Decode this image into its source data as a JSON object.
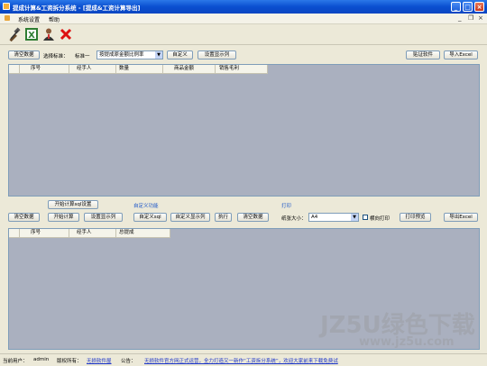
{
  "window": {
    "title": "提成计算&工资拆分系统 - [提成&工资计算导出]"
  },
  "menu": {
    "items": [
      "系统设置",
      "帮助"
    ],
    "controls": [
      "_",
      "❐",
      "×"
    ]
  },
  "top": {
    "clear_data": "清空数据",
    "select_label": "选择标准：",
    "standard_value": "标准一",
    "standard_combo": "按提成原金额比例率",
    "custom": "自定义",
    "set_columns": "设置显示列",
    "paste_software": "贴证软件",
    "import_excel": "导入Excel",
    "columns": [
      "序号",
      "经手人",
      "数量",
      "商品金额",
      "销售毛利"
    ]
  },
  "middle": {
    "start_calc_sql": "开始计算sql设置",
    "custom_func_label": "自定义功能",
    "print_label": "打印",
    "clear_data": "清空数据",
    "start_calc": "开始计算",
    "set_columns": "设置显示列",
    "custom_sql": "自定义sql",
    "custom_columns": "自定义显示列",
    "execute": "执行",
    "clear_data2": "清空数据",
    "paper_size_label": "纸张大小：",
    "paper_size_value": "A4",
    "landscape": "横向打印",
    "print_preview": "打印预览",
    "export_excel": "导出Excel"
  },
  "bottom": {
    "columns": [
      "序号",
      "经手人",
      "总提成"
    ]
  },
  "status": {
    "current_user_label": "当前用户：",
    "user": "admin",
    "copyright_label": "版权所有：",
    "owner": "无损软件屋",
    "notice_label": "公告：",
    "notice": "无损软件官方网正式运营，全力打造又一新作“工资拆分系统”，欢迎大家前来下载免费试"
  },
  "watermark": {
    "line1": "JZ5U绿色下载",
    "line2": "www.jz5u.com"
  }
}
